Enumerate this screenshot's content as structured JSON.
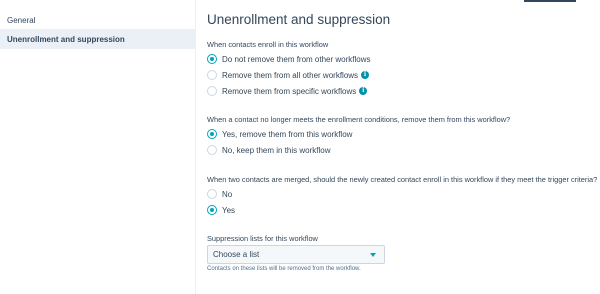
{
  "sidebar": {
    "items": [
      {
        "label": "General"
      },
      {
        "label": "Unenrollment and suppression"
      }
    ]
  },
  "main": {
    "title": "Unenrollment and suppression",
    "enroll_section": {
      "question": "When contacts enroll in this workflow",
      "options": [
        {
          "label": "Do not remove them from other workflows",
          "checked": true,
          "info": false
        },
        {
          "label": "Remove them from all other workflows",
          "checked": false,
          "info": true
        },
        {
          "label": "Remove them from specific workflows",
          "checked": false,
          "info": true
        }
      ]
    },
    "criteria_section": {
      "question": "When a contact no longer meets the enrollment conditions, remove them from this workflow?",
      "options": [
        {
          "label": "Yes, remove them from this workflow",
          "checked": true
        },
        {
          "label": "No, keep them in this workflow",
          "checked": false
        }
      ]
    },
    "merge_section": {
      "question": "When two contacts are merged, should the newly created contact enroll in this workflow if they meet the trigger criteria?",
      "options": [
        {
          "label": "No",
          "checked": false
        },
        {
          "label": "Yes",
          "checked": true
        }
      ]
    },
    "suppression": {
      "label": "Suppression lists for this workflow",
      "select_value": "Choose a list",
      "help": "Contacts on these lists will be removed from the workflow."
    },
    "info_icon_glyph": "i"
  },
  "colors": {
    "accent": "#00a4bd",
    "text": "#33475b",
    "info": "#0091ae"
  }
}
